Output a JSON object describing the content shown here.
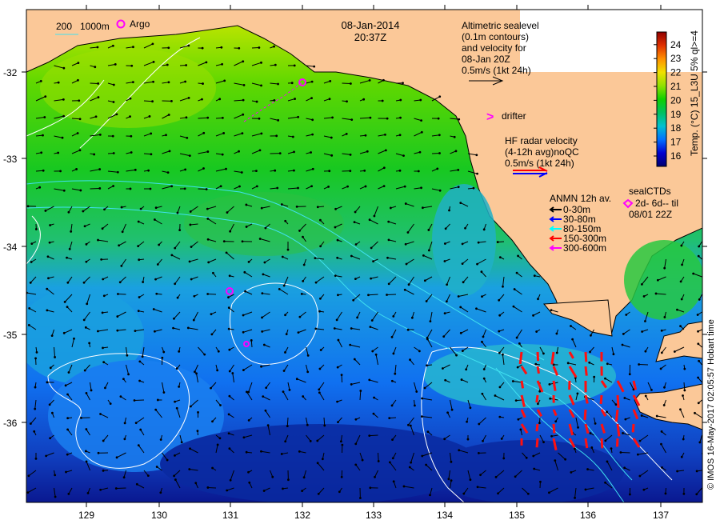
{
  "map": {
    "date": "08-Jan-2014",
    "time": "20:37Z",
    "x_ticks": [
      "129",
      "130",
      "131",
      "132",
      "133",
      "134",
      "135",
      "136",
      "137"
    ],
    "y_ticks": [
      "-32",
      "-33",
      "-34",
      "-35",
      "-36"
    ],
    "land_color": "#fbc898",
    "contour_legend": {
      "a": "200",
      "b": "1000m"
    },
    "argo_label": "Argo",
    "altimetry": {
      "lines": [
        "Altimetric sealevel",
        "(0.1m contours)",
        "and velocity for",
        "08-Jan 20Z",
        "0.5m/s (1kt 24h)"
      ]
    },
    "drifter_label": "drifter",
    "hf_radar": {
      "lines": [
        "HF radar velocity",
        "(4-12h avg)noQC",
        "0.5m/s (1kt 24h)"
      ],
      "colors": [
        "#ff0000",
        "#0000ff"
      ]
    },
    "anmn": {
      "title": "ANMN 12h av.",
      "items": [
        {
          "label": "0-30m",
          "color": "#000000"
        },
        {
          "label": "30-80m",
          "color": "#0000ff"
        },
        {
          "label": "80-150m",
          "color": "#00ffff"
        },
        {
          "label": "150-300m",
          "color": "#ff0000"
        },
        {
          "label": "300-600m",
          "color": "#ff00ff"
        }
      ]
    },
    "seal": {
      "title": "sealCTDs",
      "line1": "2d- 6d-- til",
      "line2": "08/01 22Z"
    },
    "colorbar": {
      "title": "Temp. (°C) 15_L3U 5% ql>=4",
      "ticks": [
        "16",
        "17",
        "18",
        "19",
        "20",
        "21",
        "22",
        "23",
        "24"
      ],
      "colors": [
        "#000070",
        "#0000d0",
        "#0070ff",
        "#00c0d0",
        "#00c060",
        "#10d000",
        "#90e000",
        "#f0e000",
        "#ff9000",
        "#e03000",
        "#900000"
      ]
    },
    "credit": "© IMOS 16-May-2017 02:05:57 Hobart time"
  }
}
